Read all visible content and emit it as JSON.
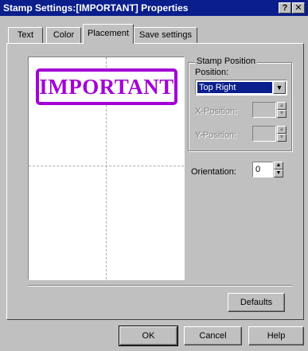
{
  "window": {
    "title": "Stamp Settings:[IMPORTANT] Properties",
    "help_label": "?",
    "close_label": "✕"
  },
  "tabs": [
    {
      "label": "Text",
      "active": false
    },
    {
      "label": "Color",
      "active": false
    },
    {
      "label": "Placement",
      "active": true
    },
    {
      "label": "Save settings",
      "active": false
    }
  ],
  "preview": {
    "stamp_text": "IMPORTANT",
    "stamp_color": "#a200d6"
  },
  "stamp_position": {
    "group_label": "Stamp Position",
    "position_label": "Position:",
    "position_value": "Top Right",
    "x_label": "X-Position:",
    "x_value": "",
    "y_label": "Y-Position:",
    "y_value": ""
  },
  "orientation": {
    "label": "Orientation:",
    "value": "0"
  },
  "buttons": {
    "defaults": "Defaults",
    "ok": "OK",
    "cancel": "Cancel",
    "help": "Help"
  }
}
